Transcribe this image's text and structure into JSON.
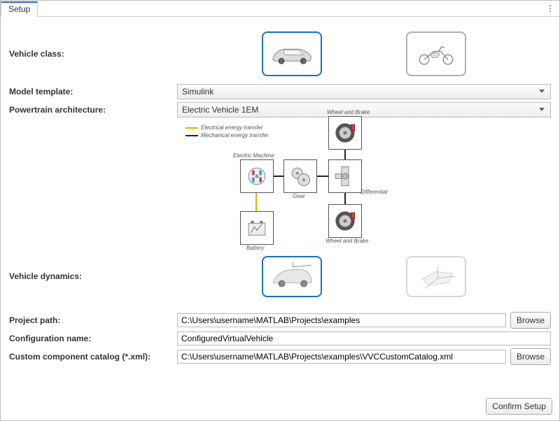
{
  "tab": {
    "label": "Setup"
  },
  "labels": {
    "vehicle_class": "Vehicle class:",
    "model_template": "Model template:",
    "powertrain_arch": "Powertrain architecture:",
    "vehicle_dynamics": "Vehicle dynamics:",
    "project_path": "Project path:",
    "configuration_name": "Configuration name:",
    "custom_catalog": "Custom component catalog (*.xml):"
  },
  "fields": {
    "model_template": "Simulink",
    "powertrain_arch": "Electric Vehicle 1EM",
    "project_path": "C:\\Users\\username\\MATLAB\\Projects\\examples",
    "configuration_name": "ConfiguredVirtualVehicle",
    "custom_catalog": "C:\\Users\\username\\MATLAB\\Projects\\examples\\VVCCustomCatalog.xml"
  },
  "buttons": {
    "browse": "Browse",
    "confirm": "Confirm Setup"
  },
  "diagram": {
    "legend_electrical": "Electrical energy transfer",
    "legend_mechanical": "Mechanical energy transfer",
    "electric_machine": "Electric Machine",
    "gear": "Gear",
    "differential": "Differential",
    "battery": "Battery",
    "wheel_brake": "Wheel and Brake"
  },
  "vehicle_class": {
    "selected": "car"
  },
  "vehicle_dynamics": {
    "selected": "longitudinal"
  }
}
